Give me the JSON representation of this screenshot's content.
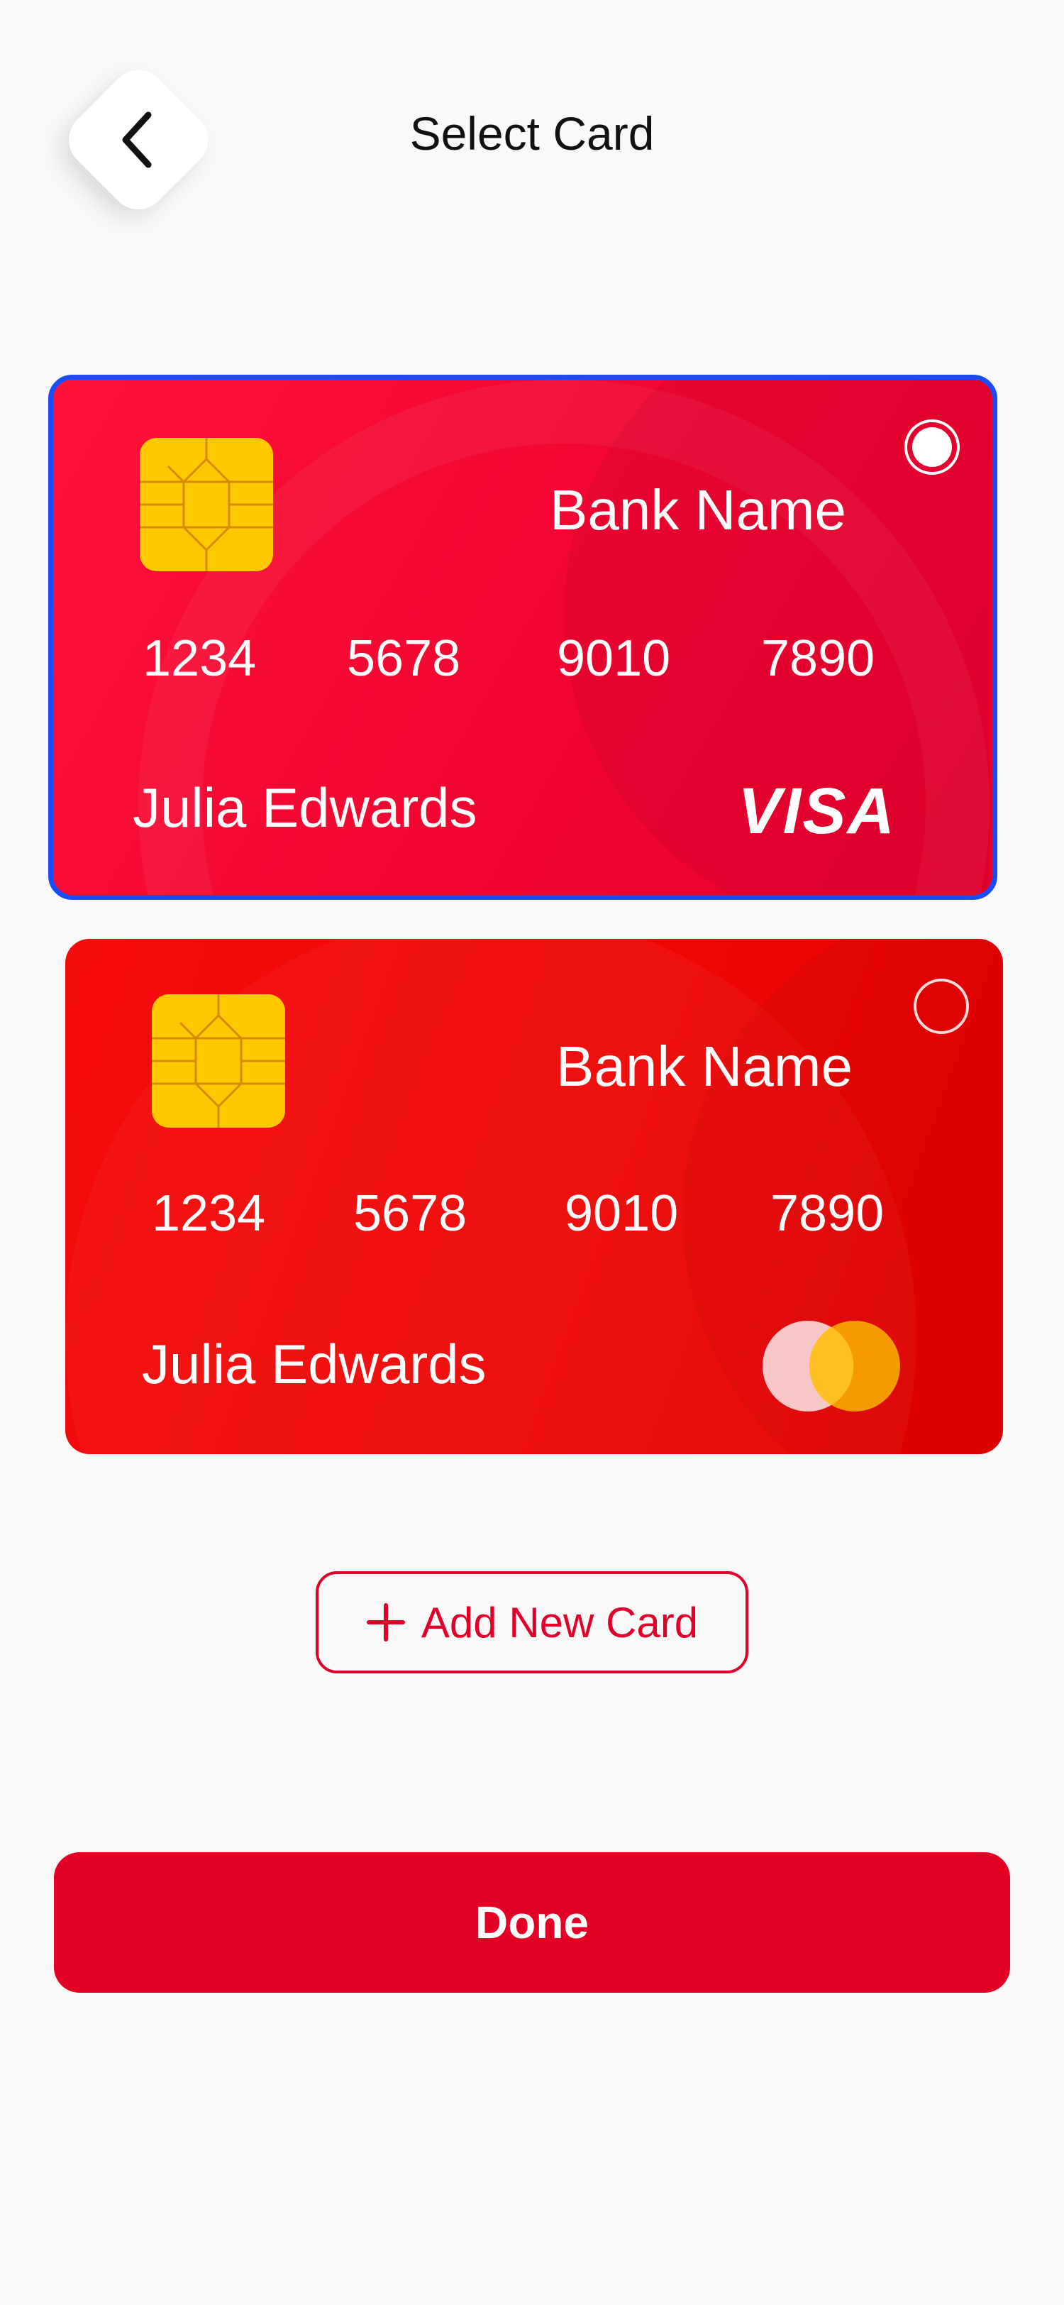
{
  "header": {
    "title": "Select Card",
    "back_icon": "chevron-left-icon"
  },
  "cards": [
    {
      "selected": true,
      "bank_name": "Bank Name",
      "number_groups": [
        "1234",
        "5678",
        "9010",
        "7890"
      ],
      "holder": "Julia Edwards",
      "network": "VISA",
      "background": "#f00531",
      "border": "#1a4cff"
    },
    {
      "selected": false,
      "bank_name": "Bank Name",
      "number_groups": [
        "1234",
        "5678",
        "9010",
        "7890"
      ],
      "holder": "Julia Edwards",
      "network_icon": "mastercard-logo-icon",
      "background": "#ee0606"
    }
  ],
  "add_card": {
    "label": "Add New Card",
    "icon": "plus-icon"
  },
  "done": {
    "label": "Done"
  },
  "colors": {
    "accent": "#e30024",
    "chip": "#ffc800",
    "selection": "#1a4cff"
  }
}
